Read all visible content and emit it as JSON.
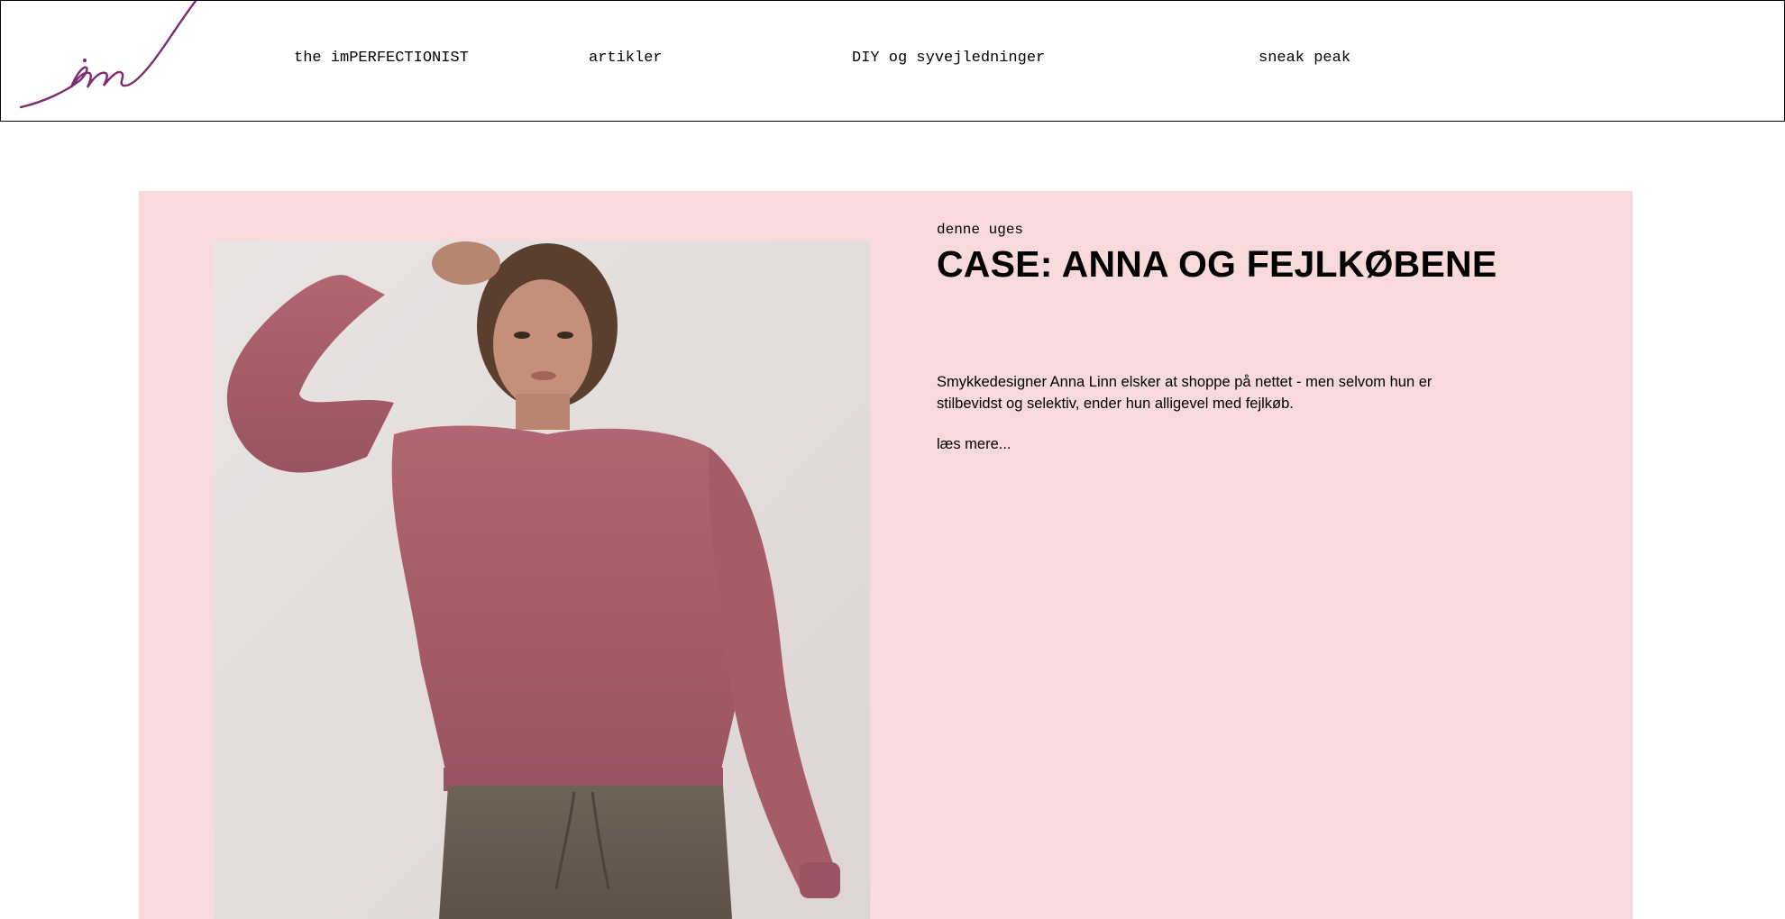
{
  "brand": {
    "logo_icon": "im-script-logo",
    "accent_color": "#7b2b6e"
  },
  "nav": {
    "items": [
      {
        "label": "the imPERFECTIONIST"
      },
      {
        "label": "artikler"
      },
      {
        "label": "DIY og syvejledninger"
      },
      {
        "label": "sneak peak"
      }
    ]
  },
  "feature": {
    "background_color": "#f8dada",
    "eyebrow": "denne uges",
    "title": "CASE: ANNA OG FEJLKØBENE",
    "excerpt": "Smykkedesigner Anna Linn elsker at shoppe på nettet - men selvom hun er stilbevidst og selektiv, ender hun alligevel med fejlkøb.",
    "read_more": "læs mere...",
    "image": {
      "subject": "model-in-pink-sweater-photo"
    }
  }
}
